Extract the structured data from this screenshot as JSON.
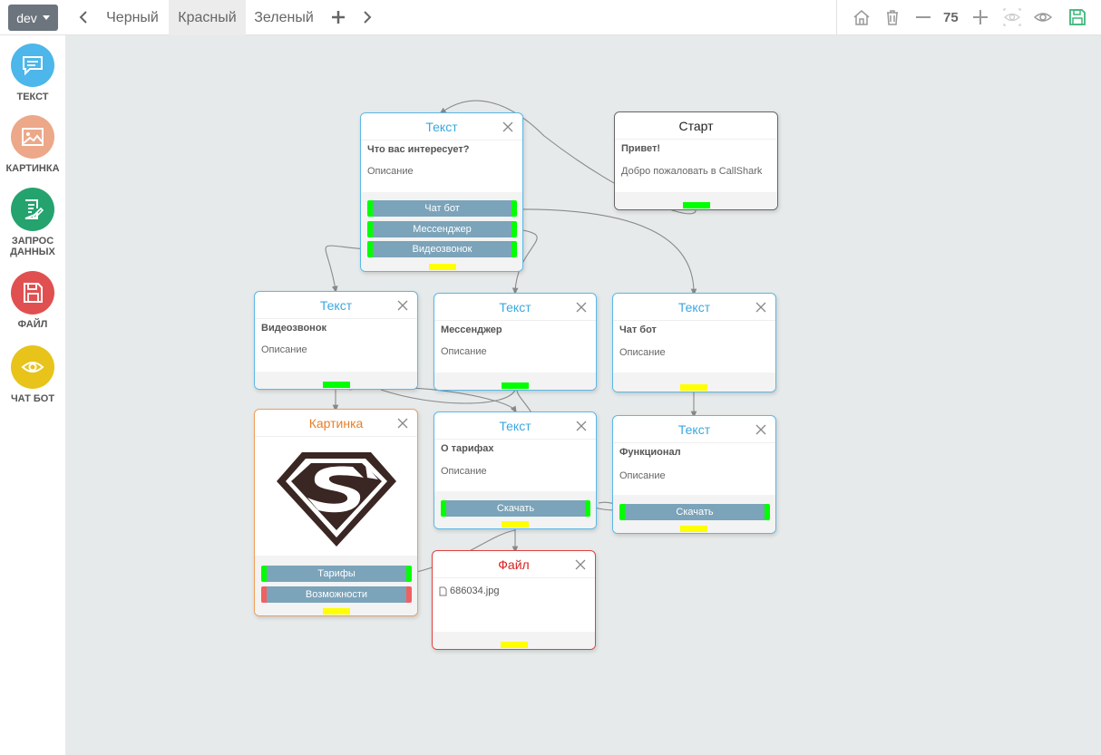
{
  "topbar": {
    "env": "dev",
    "tabs": [
      "Черный",
      "Красный",
      "Зеленый"
    ],
    "active_tab": 1,
    "zoom": "75"
  },
  "sidebar": {
    "tools": [
      {
        "label": "ТЕКСТ",
        "icon": "message-icon",
        "color": "#4db6ea"
      },
      {
        "label": "КАРТИНКА",
        "icon": "image-icon",
        "color": "#eca888"
      },
      {
        "label": "ЗАПРОС\nДАННЫХ",
        "icon": "form-icon",
        "color": "#24a36e"
      },
      {
        "label": "ФАЙЛ",
        "icon": "floppy-icon",
        "color": "#e05050"
      },
      {
        "label": "ЧАТ БОТ",
        "icon": "eye-icon",
        "color": "#e8c31a"
      }
    ]
  },
  "nodes": {
    "n1": {
      "header": "Текст",
      "title": "Что вас интересует?",
      "desc": "Описание",
      "buttons": [
        "Чат бот",
        "Мессенджер",
        "Видеозвонок"
      ]
    },
    "start": {
      "header": "Старт",
      "title": "Привет!",
      "desc": "Добро пожаловать в CallShark"
    },
    "video": {
      "header": "Текст",
      "title": "Видеозвонок",
      "desc": "Описание"
    },
    "messenger": {
      "header": "Текст",
      "title": "Мессенджер",
      "desc": "Описание"
    },
    "chatbot": {
      "header": "Текст",
      "title": "Чат бот",
      "desc": "Описание"
    },
    "picture": {
      "header": "Картинка",
      "buttons": [
        "Тарифы",
        "Возможности"
      ]
    },
    "tariffs": {
      "header": "Текст",
      "title": "О тарифах",
      "desc": "Описание",
      "buttons": [
        "Скачать"
      ]
    },
    "features": {
      "header": "Текст",
      "title": "Функционал",
      "desc": "Описание",
      "buttons": [
        "Скачать"
      ]
    },
    "file": {
      "header": "Файл",
      "filename": "686034.jpg"
    }
  }
}
